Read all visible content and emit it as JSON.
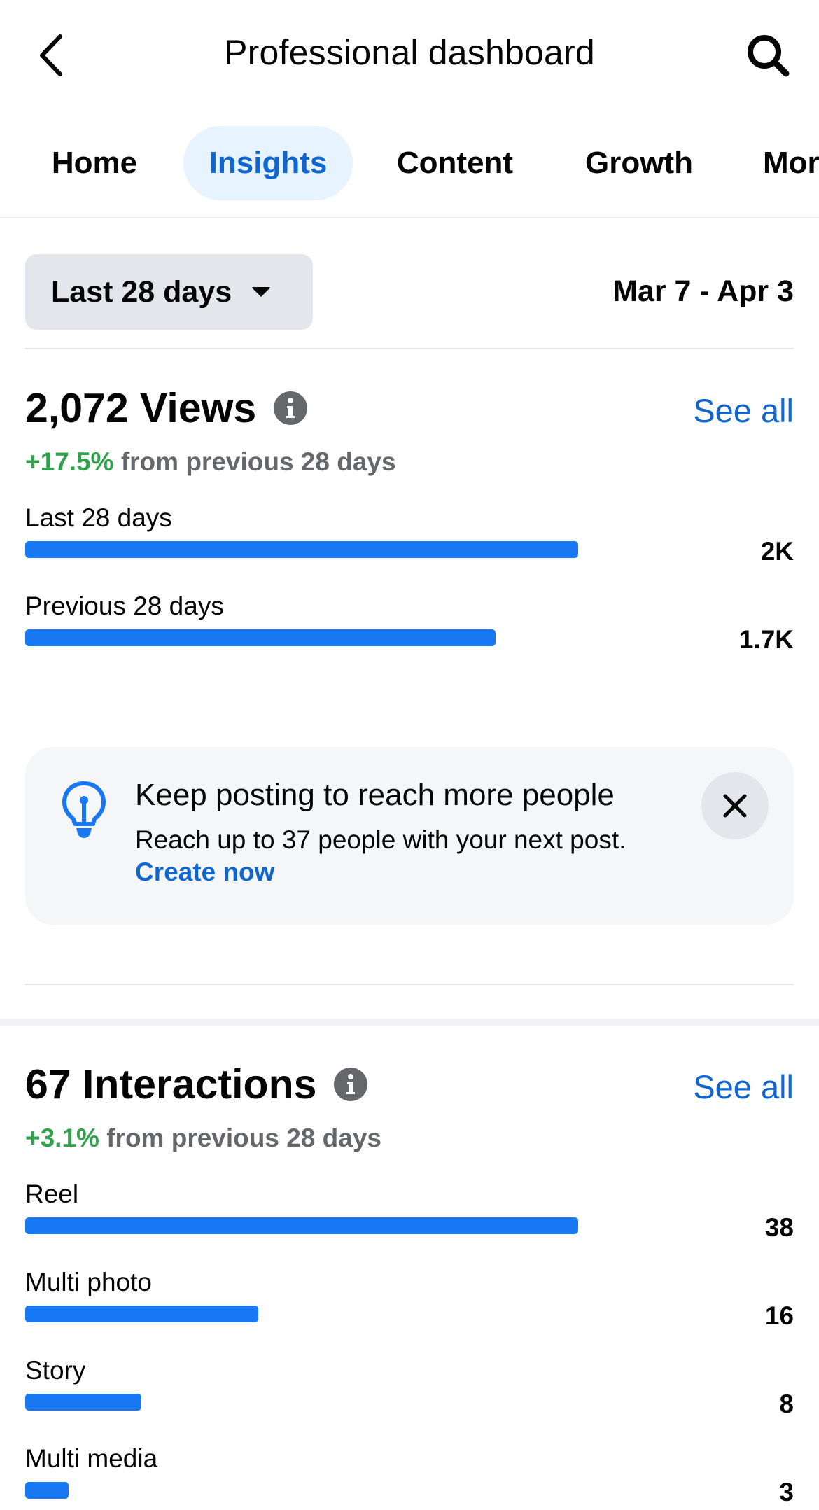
{
  "header": {
    "title": "Professional dashboard",
    "back_icon": "chevron-left-icon",
    "search_icon": "search-icon"
  },
  "tabs": [
    {
      "label": "Home",
      "active": false
    },
    {
      "label": "Insights",
      "active": true
    },
    {
      "label": "Content",
      "active": false
    },
    {
      "label": "Growth",
      "active": false
    },
    {
      "label": "Mor",
      "active": false
    }
  ],
  "filter": {
    "range_label": "Last 28 days",
    "date_range": "Mar 7 - Apr 3"
  },
  "views": {
    "title": "2,072 Views",
    "see_all": "See all",
    "delta_pct": "+17.5%",
    "delta_text": "from previous 28 days",
    "bars": [
      {
        "label": "Last 28 days",
        "value_label": "2K",
        "value": 2072
      },
      {
        "label": "Previous 28 days",
        "value_label": "1.7K",
        "value": 1763
      }
    ]
  },
  "tip": {
    "title": "Keep posting to reach more people",
    "body": "Reach up to 37 people with your next post.",
    "link": "Create now"
  },
  "interactions": {
    "title": "67 Interactions",
    "see_all": "See all",
    "delta_pct": "+3.1%",
    "delta_text": "from previous 28 days",
    "bars": [
      {
        "label": "Reel",
        "value_label": "38",
        "value": 38
      },
      {
        "label": "Multi photo",
        "value_label": "16",
        "value": 16
      },
      {
        "label": "Story",
        "value_label": "8",
        "value": 8
      },
      {
        "label": "Multi media",
        "value_label": "3",
        "value": 3
      }
    ]
  },
  "colors": {
    "accent": "#1877f2",
    "link": "#1066d0",
    "positive": "#31a24c",
    "muted": "#65676b"
  }
}
